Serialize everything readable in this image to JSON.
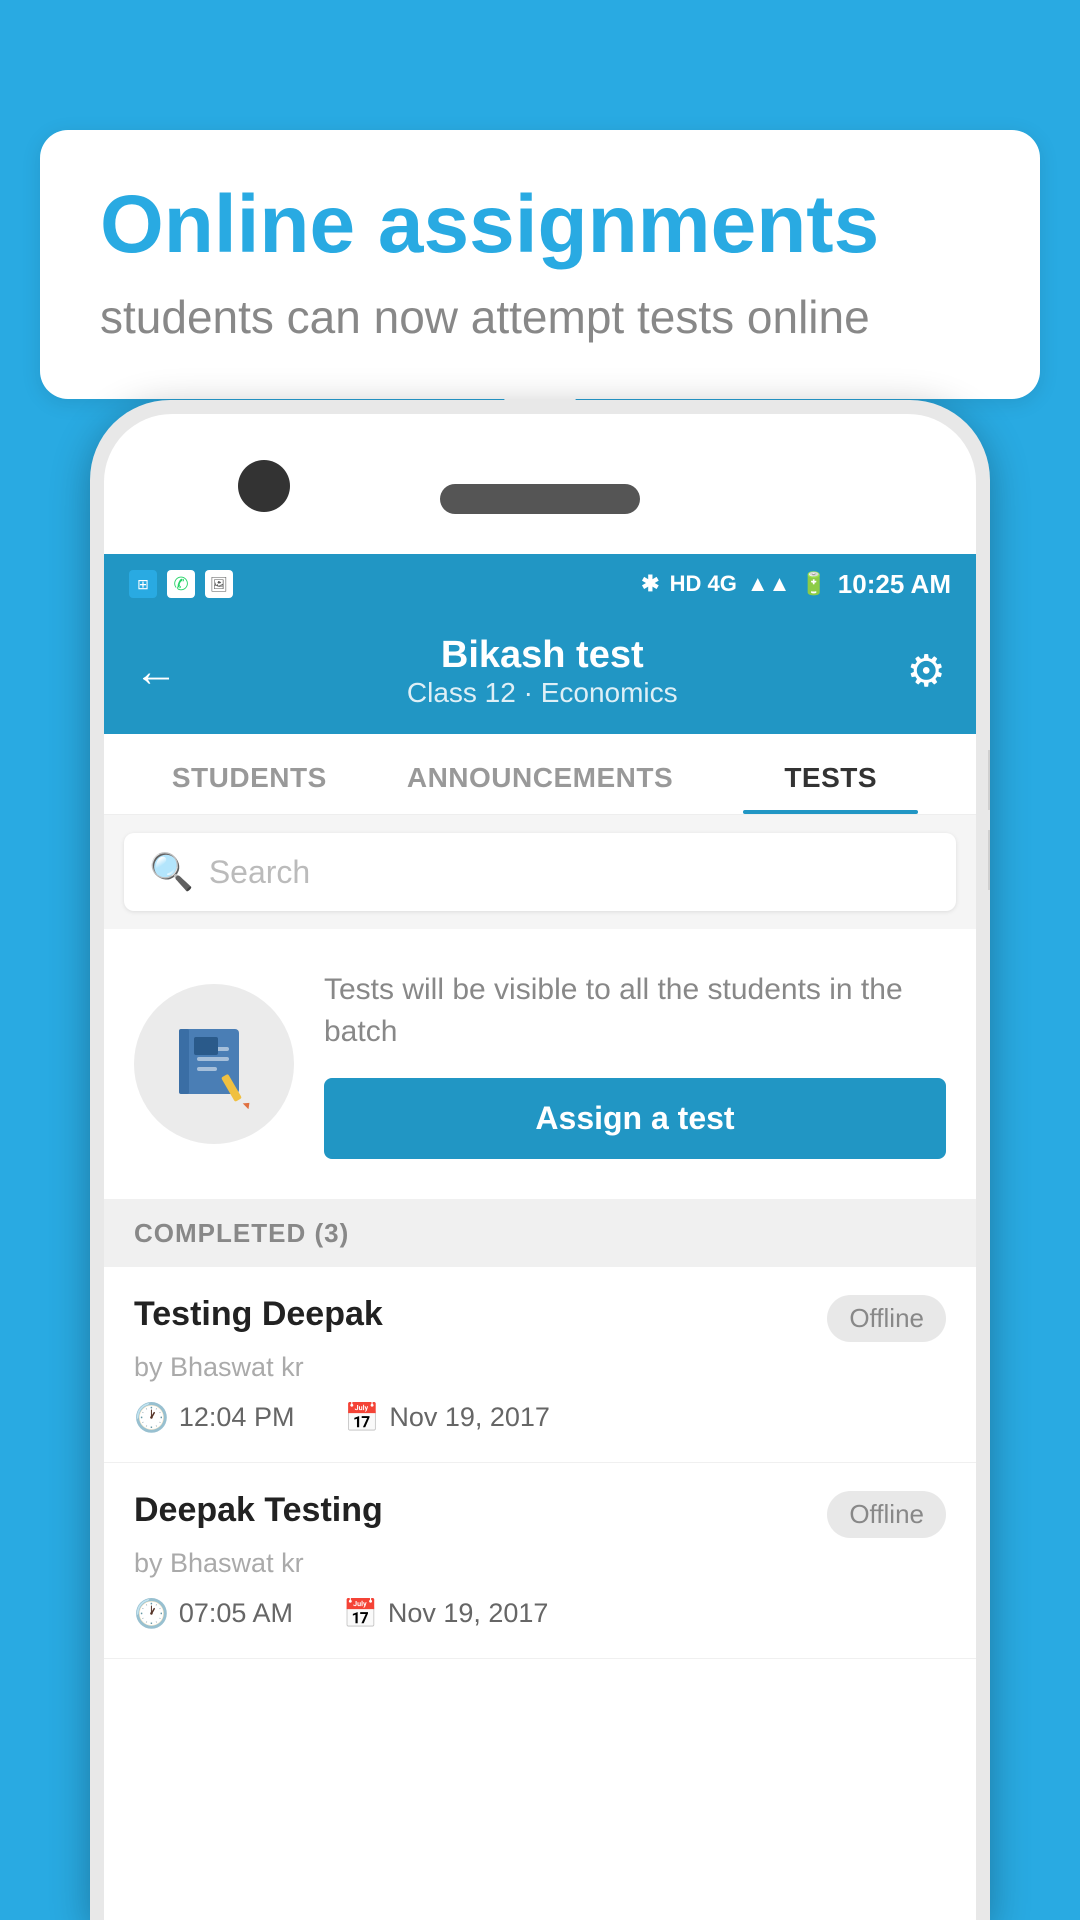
{
  "bubble": {
    "title": "Online assignments",
    "subtitle": "students can now attempt tests online"
  },
  "statusBar": {
    "time": "10:25 AM",
    "network": "HD 4G"
  },
  "header": {
    "title": "Bikash test",
    "subtitle": "Class 12 · Economics",
    "back_label": "←",
    "gear_label": "⚙"
  },
  "tabs": [
    {
      "label": "STUDENTS",
      "active": false
    },
    {
      "label": "ANNOUNCEMENTS",
      "active": false
    },
    {
      "label": "TESTS",
      "active": true
    }
  ],
  "search": {
    "placeholder": "Search"
  },
  "assignSection": {
    "description": "Tests will be visible to all the students in the batch",
    "button_label": "Assign a test"
  },
  "completed": {
    "header": "COMPLETED (3)",
    "items": [
      {
        "name": "Testing Deepak",
        "author": "by Bhaswat kr",
        "time": "12:04 PM",
        "date": "Nov 19, 2017",
        "badge": "Offline"
      },
      {
        "name": "Deepak Testing",
        "author": "by Bhaswat kr",
        "time": "07:05 AM",
        "date": "Nov 19, 2017",
        "badge": "Offline"
      }
    ]
  }
}
